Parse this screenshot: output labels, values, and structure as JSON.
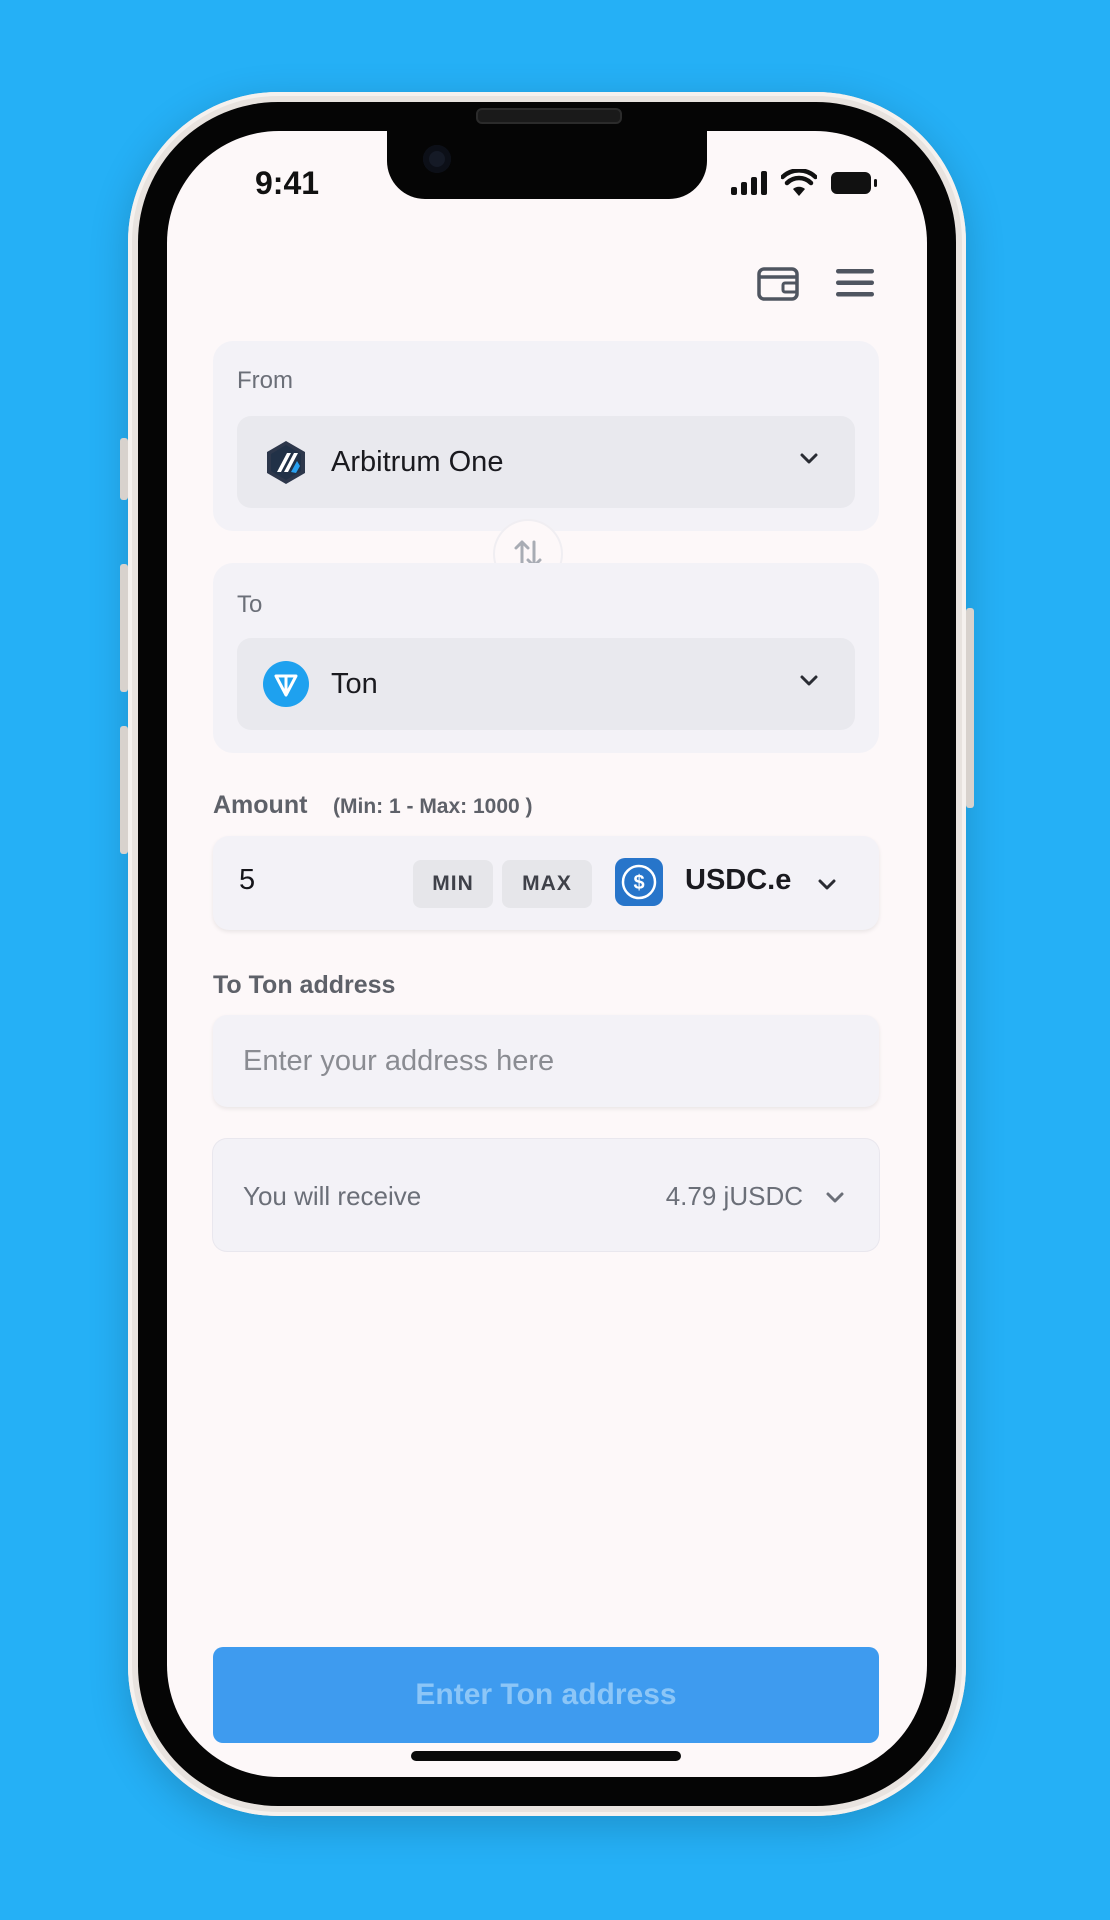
{
  "status_bar": {
    "time": "9:41"
  },
  "from": {
    "label": "From",
    "network": "Arbitrum One",
    "icon": "arbitrum-logo-icon"
  },
  "to": {
    "label": "To",
    "network": "Ton",
    "icon": "ton-logo-icon"
  },
  "amount": {
    "label": "Amount",
    "limits": "(Min: 1  - Max:  1000 )",
    "value": "5",
    "min_label": "MIN",
    "max_label": "MAX",
    "token": "USDC.e",
    "token_icon": "usdc-logo-icon"
  },
  "address": {
    "label": "To Ton address",
    "placeholder": "Enter your address here"
  },
  "receive": {
    "label": "You will receive",
    "value": "4.79 jUSDC"
  },
  "submit": {
    "label": "Enter Ton address"
  },
  "colors": {
    "background": "#25b0f6",
    "screen": "#fdf8f9",
    "card": "#f3f2f7",
    "button": "#3e9bef",
    "ton_blue": "#1ea1ef",
    "usdc_blue": "#2775ca"
  }
}
